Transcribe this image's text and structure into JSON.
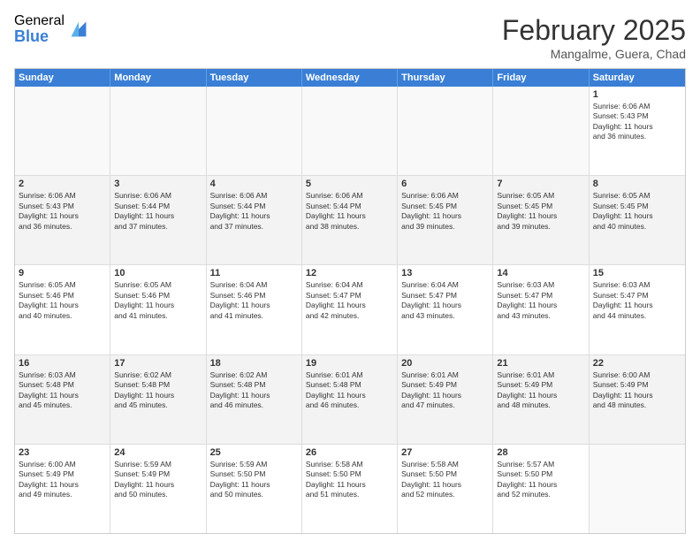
{
  "logo": {
    "general": "General",
    "blue": "Blue"
  },
  "title": "February 2025",
  "location": "Mangalme, Guera, Chad",
  "days": [
    "Sunday",
    "Monday",
    "Tuesday",
    "Wednesday",
    "Thursday",
    "Friday",
    "Saturday"
  ],
  "weeks": [
    [
      {
        "day": "",
        "text": ""
      },
      {
        "day": "",
        "text": ""
      },
      {
        "day": "",
        "text": ""
      },
      {
        "day": "",
        "text": ""
      },
      {
        "day": "",
        "text": ""
      },
      {
        "day": "",
        "text": ""
      },
      {
        "day": "1",
        "text": "Sunrise: 6:06 AM\nSunset: 5:43 PM\nDaylight: 11 hours\nand 36 minutes."
      }
    ],
    [
      {
        "day": "2",
        "text": "Sunrise: 6:06 AM\nSunset: 5:43 PM\nDaylight: 11 hours\nand 36 minutes."
      },
      {
        "day": "3",
        "text": "Sunrise: 6:06 AM\nSunset: 5:44 PM\nDaylight: 11 hours\nand 37 minutes."
      },
      {
        "day": "4",
        "text": "Sunrise: 6:06 AM\nSunset: 5:44 PM\nDaylight: 11 hours\nand 37 minutes."
      },
      {
        "day": "5",
        "text": "Sunrise: 6:06 AM\nSunset: 5:44 PM\nDaylight: 11 hours\nand 38 minutes."
      },
      {
        "day": "6",
        "text": "Sunrise: 6:06 AM\nSunset: 5:45 PM\nDaylight: 11 hours\nand 39 minutes."
      },
      {
        "day": "7",
        "text": "Sunrise: 6:05 AM\nSunset: 5:45 PM\nDaylight: 11 hours\nand 39 minutes."
      },
      {
        "day": "8",
        "text": "Sunrise: 6:05 AM\nSunset: 5:45 PM\nDaylight: 11 hours\nand 40 minutes."
      }
    ],
    [
      {
        "day": "9",
        "text": "Sunrise: 6:05 AM\nSunset: 5:46 PM\nDaylight: 11 hours\nand 40 minutes."
      },
      {
        "day": "10",
        "text": "Sunrise: 6:05 AM\nSunset: 5:46 PM\nDaylight: 11 hours\nand 41 minutes."
      },
      {
        "day": "11",
        "text": "Sunrise: 6:04 AM\nSunset: 5:46 PM\nDaylight: 11 hours\nand 41 minutes."
      },
      {
        "day": "12",
        "text": "Sunrise: 6:04 AM\nSunset: 5:47 PM\nDaylight: 11 hours\nand 42 minutes."
      },
      {
        "day": "13",
        "text": "Sunrise: 6:04 AM\nSunset: 5:47 PM\nDaylight: 11 hours\nand 43 minutes."
      },
      {
        "day": "14",
        "text": "Sunrise: 6:03 AM\nSunset: 5:47 PM\nDaylight: 11 hours\nand 43 minutes."
      },
      {
        "day": "15",
        "text": "Sunrise: 6:03 AM\nSunset: 5:47 PM\nDaylight: 11 hours\nand 44 minutes."
      }
    ],
    [
      {
        "day": "16",
        "text": "Sunrise: 6:03 AM\nSunset: 5:48 PM\nDaylight: 11 hours\nand 45 minutes."
      },
      {
        "day": "17",
        "text": "Sunrise: 6:02 AM\nSunset: 5:48 PM\nDaylight: 11 hours\nand 45 minutes."
      },
      {
        "day": "18",
        "text": "Sunrise: 6:02 AM\nSunset: 5:48 PM\nDaylight: 11 hours\nand 46 minutes."
      },
      {
        "day": "19",
        "text": "Sunrise: 6:01 AM\nSunset: 5:48 PM\nDaylight: 11 hours\nand 46 minutes."
      },
      {
        "day": "20",
        "text": "Sunrise: 6:01 AM\nSunset: 5:49 PM\nDaylight: 11 hours\nand 47 minutes."
      },
      {
        "day": "21",
        "text": "Sunrise: 6:01 AM\nSunset: 5:49 PM\nDaylight: 11 hours\nand 48 minutes."
      },
      {
        "day": "22",
        "text": "Sunrise: 6:00 AM\nSunset: 5:49 PM\nDaylight: 11 hours\nand 48 minutes."
      }
    ],
    [
      {
        "day": "23",
        "text": "Sunrise: 6:00 AM\nSunset: 5:49 PM\nDaylight: 11 hours\nand 49 minutes."
      },
      {
        "day": "24",
        "text": "Sunrise: 5:59 AM\nSunset: 5:49 PM\nDaylight: 11 hours\nand 50 minutes."
      },
      {
        "day": "25",
        "text": "Sunrise: 5:59 AM\nSunset: 5:50 PM\nDaylight: 11 hours\nand 50 minutes."
      },
      {
        "day": "26",
        "text": "Sunrise: 5:58 AM\nSunset: 5:50 PM\nDaylight: 11 hours\nand 51 minutes."
      },
      {
        "day": "27",
        "text": "Sunrise: 5:58 AM\nSunset: 5:50 PM\nDaylight: 11 hours\nand 52 minutes."
      },
      {
        "day": "28",
        "text": "Sunrise: 5:57 AM\nSunset: 5:50 PM\nDaylight: 11 hours\nand 52 minutes."
      },
      {
        "day": "",
        "text": ""
      }
    ]
  ]
}
